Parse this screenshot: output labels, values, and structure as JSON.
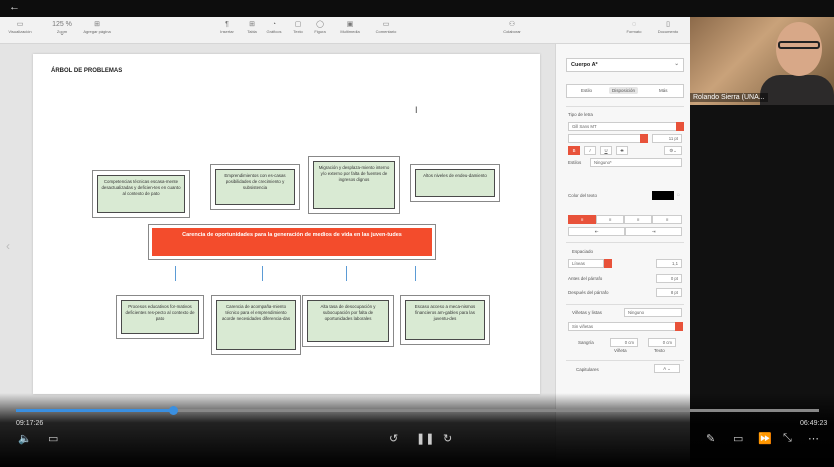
{
  "topbar": {
    "back_icon": "←"
  },
  "toolbar": {
    "items": [
      {
        "icon": "▭",
        "label": "Visualización"
      },
      {
        "icon": "125 % ⌄",
        "label": "Zoom"
      },
      {
        "icon": "⊞",
        "label": "Agregar página"
      },
      {
        "icon": "¶",
        "label": "Insertar"
      },
      {
        "icon": "⊞",
        "label": "Tabla"
      },
      {
        "icon": "◔",
        "label": "Gráficos"
      },
      {
        "icon": "▢",
        "label": "Texto"
      },
      {
        "icon": "◯",
        "label": "Figura"
      },
      {
        "icon": "▣",
        "label": "Multimedia"
      },
      {
        "icon": "▭",
        "label": "Comentario"
      },
      {
        "icon": "⚇",
        "label": "Colaborar"
      },
      {
        "icon": "◌",
        "label": "Formato"
      },
      {
        "icon": "▯",
        "label": "Documento"
      }
    ],
    "right_caption": "Texto"
  },
  "document": {
    "title": "ÁRBOL DE PROBLEMAS",
    "effects": [
      "Competencias técnicas escasa-mente desactualizadas y deficien-tes en cuanto al contexto de pato",
      "Emprendimientos con es-casas posibilidades de crecimiento y subsistencia",
      "Migración y desplaza-miento interno y/o externo por falta de fuentes de ingresos dignos",
      "Altos niveles de endeu-damiento"
    ],
    "central_problem": "Carencia de oportunidades para la generación de medios de vida en las juven-tudes",
    "causes": [
      "Procesos educativos for-mativos deficientes res-pecto al contexto de pato",
      "Carencia de acompaña-miento técnico para el emprendimiento acorde necesidades diferencia-das",
      "Alta tasa de desocupación y subocupación por falta de oportunidades laborales",
      "Escaso acceso a meca-nismos financieros am-gables para las juventu-des"
    ]
  },
  "sidebar": {
    "style_name": "Cuerpo A*",
    "tabs": [
      "Estilo",
      "Disposición",
      "Más"
    ],
    "font_section": "Tipo de letra",
    "font_name": "Gill Sans MT",
    "font_size": "11 pt",
    "char_styles_label": "Estilos",
    "char_styles_value": "Ninguno*",
    "text_color_label": "Color del texto",
    "spacing_label": "Espaciado",
    "spacing_type": "Líneas",
    "spacing_value": "1,1",
    "before_label": "Antes del párrafo",
    "before_value": "0 pt",
    "after_label": "Después del párrafo",
    "after_value": "8 pt",
    "bullets_label": "Viñetas y listas",
    "bullets_value": "Ninguno",
    "bullets_sub": "Sin viñetas",
    "indent_label": "Sangría",
    "indent_bullet": "0 cm",
    "indent_text": "0 cm",
    "indent_bullet_caption": "Viñeta",
    "indent_text_caption": "Texto",
    "capitals_label": "Capitulares"
  },
  "video": {
    "participant_name": "Rolando Sierra (UNA..."
  },
  "player": {
    "elapsed": "09:17:26",
    "remaining": "06:49:23",
    "progress_fraction": 0.195
  }
}
